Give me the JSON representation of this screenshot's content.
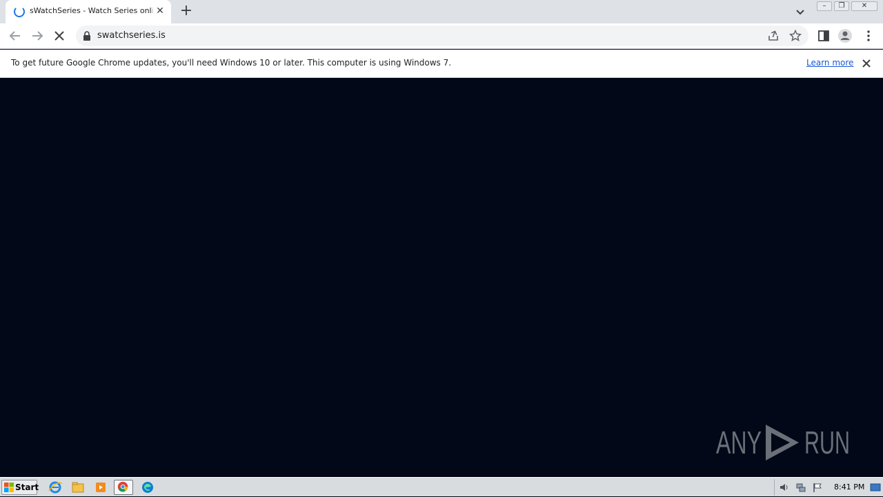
{
  "browser": {
    "tab_title": "sWatchSeries - Watch Series online, ",
    "url": "swatchseries.is"
  },
  "infobar": {
    "message": "To get future Google Chrome updates, you'll need Windows 10 or later. This computer is using Windows 7.",
    "learn_more": "Learn more"
  },
  "watermark": {
    "text_left": "ANY",
    "text_right": "RUN"
  },
  "taskbar": {
    "start_label": "Start",
    "clock": "8:41 PM"
  },
  "colors": {
    "page_background": "#020817",
    "tabstrip": "#dee1e6",
    "accent": "#1a73e8"
  }
}
